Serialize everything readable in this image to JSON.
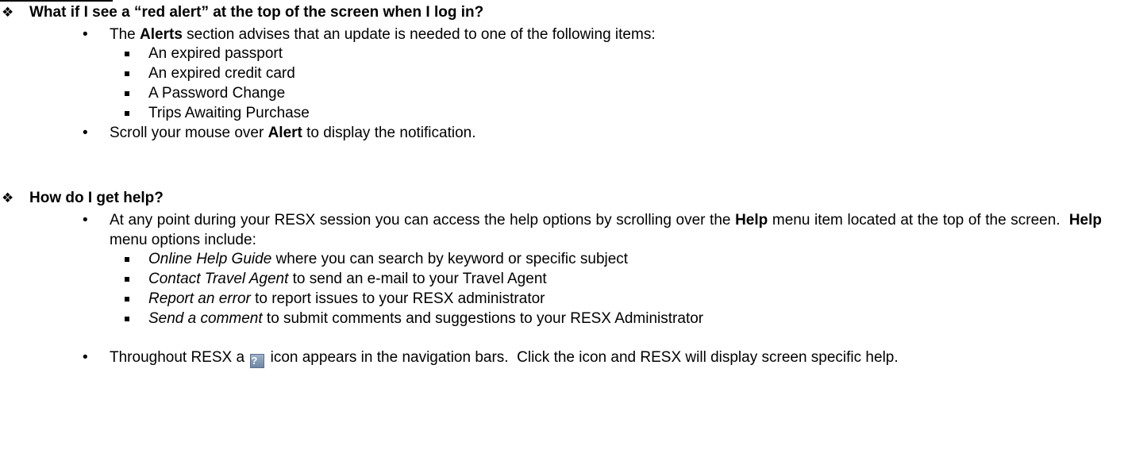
{
  "q1": {
    "question": "What if I see a “red alert” at the top of the screen when I log in?",
    "alerts_intro": {
      "pre": "The ",
      "bold": "Alerts",
      "post": " section advises that an update is needed to one of the following items:"
    },
    "items": [
      "An expired passport",
      "An expired credit card",
      "A Password Change",
      "Trips Awaiting Purchase"
    ],
    "scroll_tip": {
      "pre": "Scroll your mouse over ",
      "bold": "Alert",
      "post": " to display the notification."
    }
  },
  "q2": {
    "question": "How do I get help?",
    "help_intro": {
      "part1": "At any point during your RESX session you can access the help options by scrolling over the ",
      "bold1": "Help",
      "part2": " menu item located at the top of the screen.  ",
      "bold2": "Help",
      "part3": " menu options include:"
    },
    "options": [
      {
        "term": "Online Help Guide",
        "desc": " where you can search by keyword or specific subject"
      },
      {
        "term": "Contact Travel Agent",
        "desc": " to send an e-mail to your Travel Agent"
      },
      {
        "term": "Report an error",
        "desc": " to report issues to your RESX administrator"
      },
      {
        "term": "Send a comment",
        "desc": " to submit comments and suggestions to your RESX Administrator"
      }
    ],
    "icon_tip": {
      "pre": "Throughout RESX a ",
      "icon_glyph": "?",
      "post": " icon appears in the navigation bars.  Click the icon and RESX will display screen specific help."
    }
  },
  "bullets": {
    "question": "❖",
    "level1": "•"
  }
}
